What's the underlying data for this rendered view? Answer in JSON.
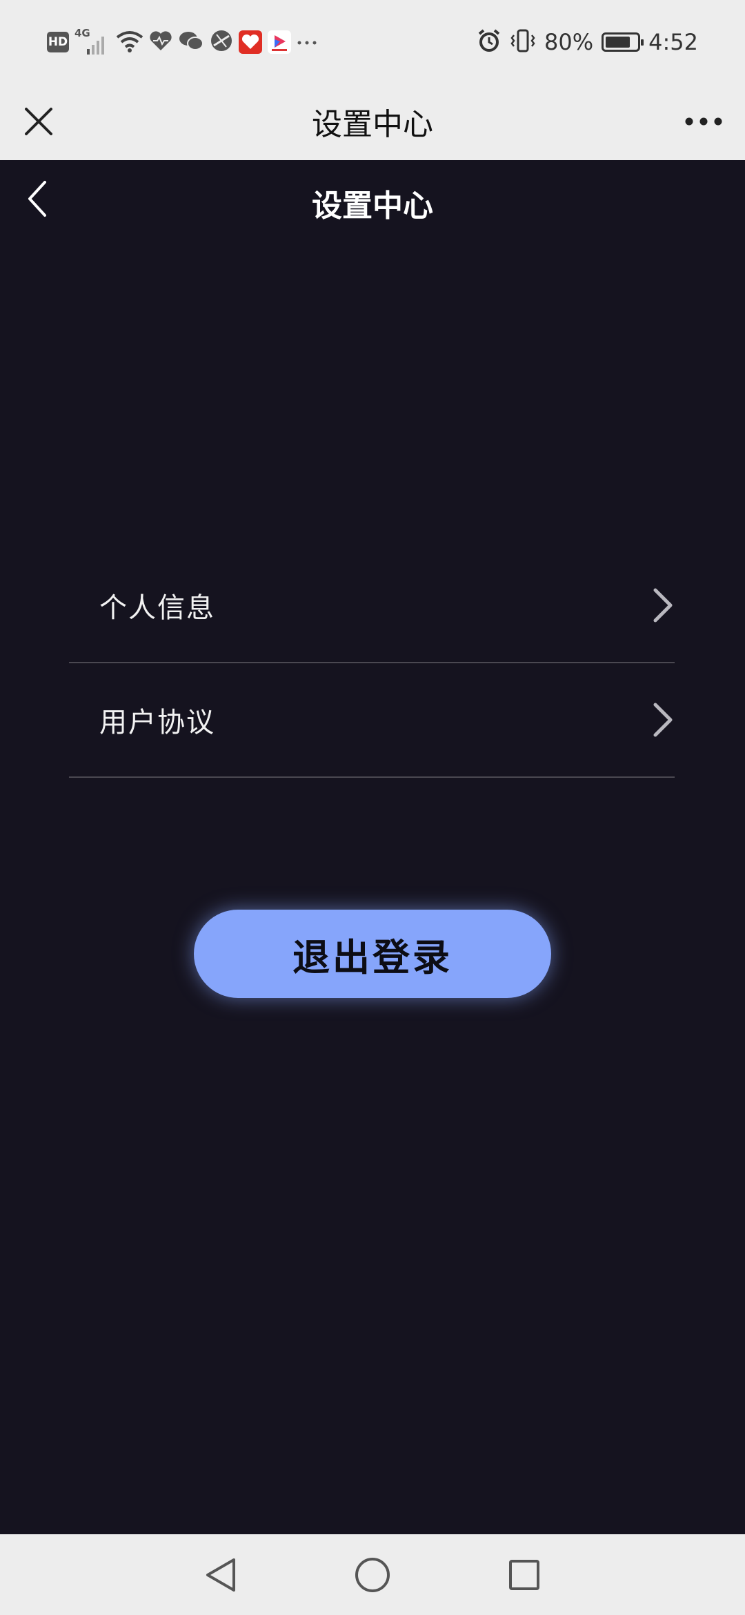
{
  "status_bar": {
    "hd": "HD",
    "network": "4G",
    "battery_percent": "80%",
    "battery_level": 0.8,
    "time": "4:52"
  },
  "top_nav": {
    "title": "设置中心"
  },
  "page": {
    "title": "设置中心"
  },
  "menu": {
    "items": [
      {
        "label": "个人信息"
      },
      {
        "label": "用户协议"
      }
    ]
  },
  "logout": {
    "label": "退出登录"
  },
  "colors": {
    "background": "#15131f",
    "accent": "#86a5fb",
    "chrome": "#ededed"
  }
}
